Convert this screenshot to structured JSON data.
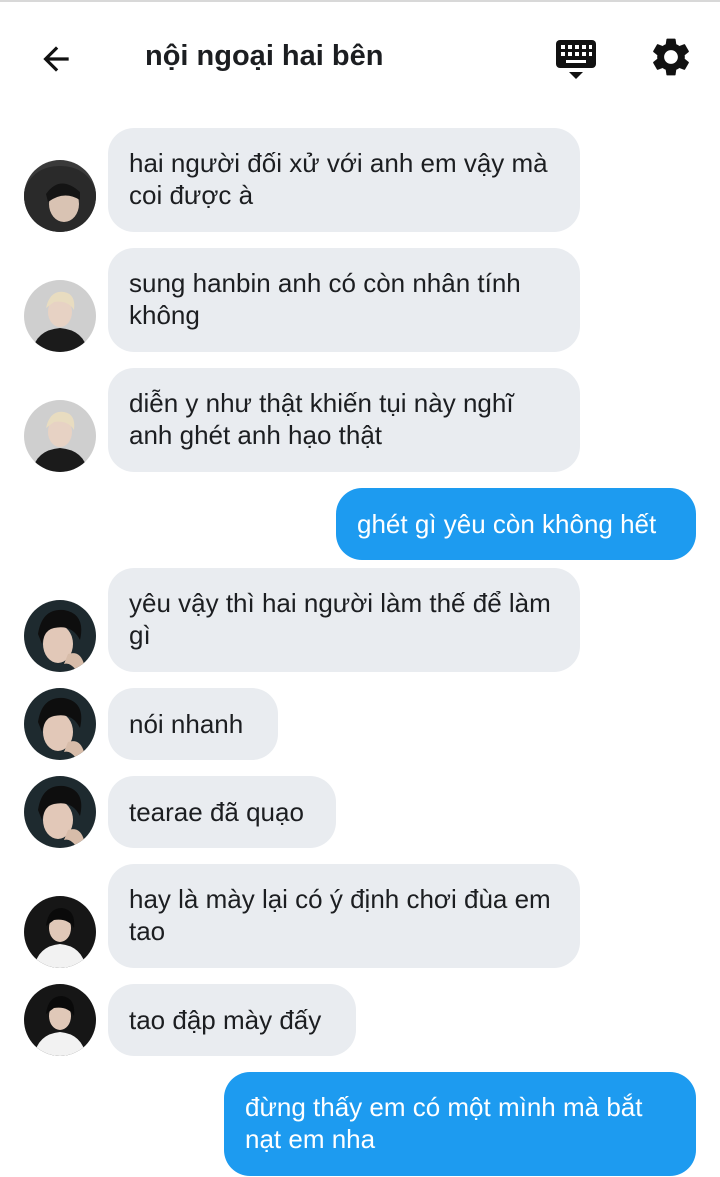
{
  "header": {
    "title": "nội ngoại hai bên",
    "back_icon": "arrow-left-icon",
    "keyboard_icon": "keyboard-icon",
    "settings_icon": "gear-icon"
  },
  "messages": [
    {
      "side": "in",
      "avatar": "avatar-hood",
      "text": "hai người đối xử với anh em vậy mà coi được à"
    },
    {
      "side": "in",
      "avatar": "avatar-blond",
      "text": "sung hanbin anh có còn nhân tính không"
    },
    {
      "side": "in",
      "avatar": "avatar-blond",
      "text": "diễn y như thật khiến tụi này nghĩ anh ghét anh hạo thật"
    },
    {
      "side": "out",
      "text": "ghét gì yêu còn không hết"
    },
    {
      "side": "in",
      "avatar": "avatar-dark-hair",
      "text": "yêu vậy thì hai người làm thế để làm gì"
    },
    {
      "side": "in",
      "avatar": "avatar-dark-hair",
      "text": "nói nhanh"
    },
    {
      "side": "in",
      "avatar": "avatar-dark-hair",
      "text": "tearae đã quạo"
    },
    {
      "side": "in",
      "avatar": "avatar-white-shirt",
      "text": "hay là mày lại có ý định chơi đùa em tao"
    },
    {
      "side": "in",
      "avatar": "avatar-white-shirt",
      "text": "tao đập mày đấy"
    },
    {
      "side": "out",
      "text": "đừng thấy em có một mình mà bắt nạt em nha"
    }
  ],
  "colors": {
    "incoming_bubble": "#e9ecf0",
    "outgoing_bubble": "#1d9bf0",
    "text": "#1c1e21"
  }
}
